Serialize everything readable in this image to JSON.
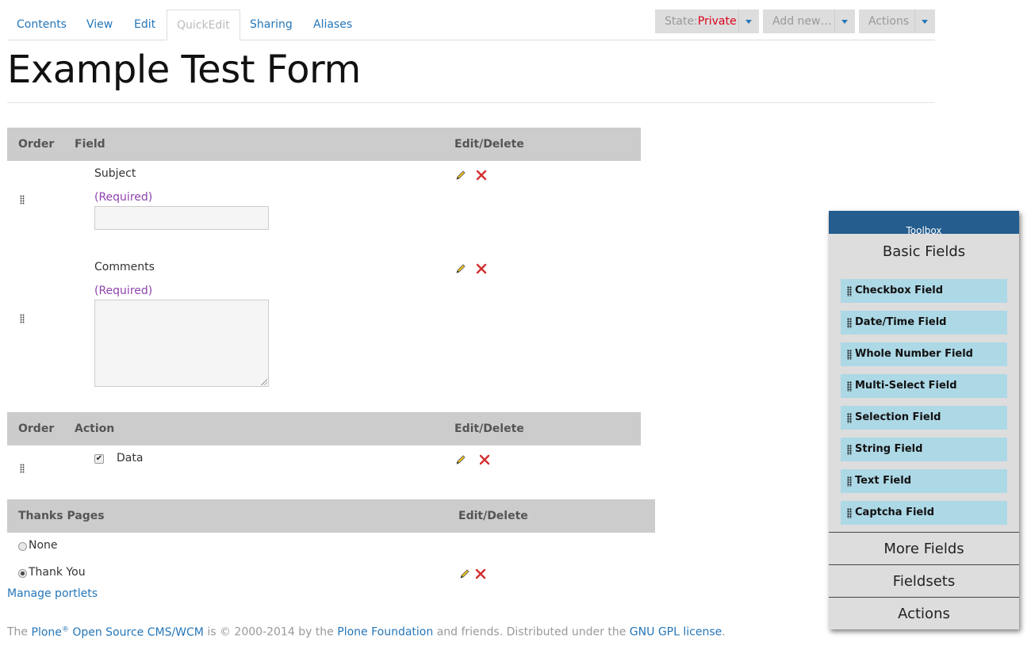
{
  "tabs": [
    {
      "label": "Contents"
    },
    {
      "label": "View"
    },
    {
      "label": "Edit"
    },
    {
      "label": "QuickEdit"
    },
    {
      "label": "Sharing"
    },
    {
      "label": "Aliases"
    }
  ],
  "toolbar": {
    "state_prefix": "State:",
    "state_value": "Private",
    "add_new": "Add new…",
    "actions": "Actions"
  },
  "page": {
    "title": "Example Test Form"
  },
  "fields_table": {
    "headers": {
      "order": "Order",
      "field": "Field",
      "edit_delete": "Edit/Delete"
    },
    "rows": [
      {
        "label": "Subject",
        "required": "(Required)"
      },
      {
        "label": "Comments",
        "required": "(Required)"
      }
    ]
  },
  "actions_table": {
    "headers": {
      "order": "Order",
      "action": "Action",
      "edit_delete": "Edit/Delete"
    },
    "rows": [
      {
        "label": "Data",
        "checked": true
      }
    ]
  },
  "thanks_table": {
    "headers": {
      "thanks": "Thanks Pages",
      "edit_delete": "Edit/Delete"
    },
    "rows": [
      {
        "label": "None",
        "selected": false
      },
      {
        "label": "Thank You",
        "selected": true
      }
    ]
  },
  "links": {
    "manage_portlets": "Manage portlets"
  },
  "footer": {
    "the": "The",
    "plone": "Plone",
    "reg": "®",
    "cms": "Open Source CMS/WCM",
    "copy": "is © 2000-2014 by the",
    "foundation": "Plone Foundation",
    "friends": "and friends. Distributed under the",
    "license": "GNU GPL license",
    "period": "."
  },
  "toolbox": {
    "title": "Toolbox",
    "basic_fields": "Basic Fields",
    "items": [
      "Checkbox Field",
      "Date/Time Field",
      "Whole Number Field",
      "Multi-Select Field",
      "Selection Field",
      "String Field",
      "Text Field",
      "Captcha Field"
    ],
    "more_fields": "More Fields",
    "fieldsets": "Fieldsets",
    "actions": "Actions"
  },
  "colors": {
    "link": "#2576b8",
    "state_private": "#d9001b",
    "required": "#8e44ad",
    "toolbox_header": "#245d8e",
    "toolbox_item": "#add8e6"
  }
}
